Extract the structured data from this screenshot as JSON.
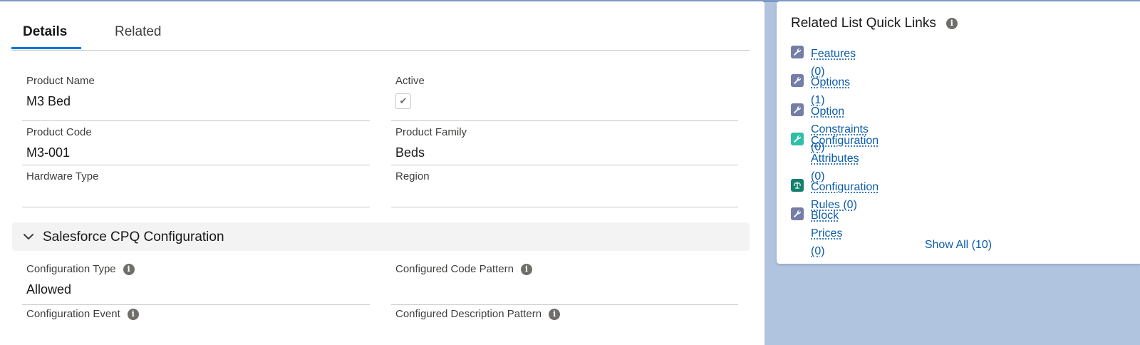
{
  "tabs": [
    {
      "label": "Details"
    },
    {
      "label": "Related"
    }
  ],
  "fields": {
    "product_name": {
      "label": "Product Name",
      "value": "M3 Bed"
    },
    "active": {
      "label": "Active",
      "checked": true
    },
    "product_code": {
      "label": "Product Code",
      "value": "M3-001"
    },
    "product_family": {
      "label": "Product Family",
      "value": "Beds"
    },
    "hardware_type": {
      "label": "Hardware Type",
      "value": ""
    },
    "region": {
      "label": "Region",
      "value": ""
    }
  },
  "section": {
    "title": "Salesforce CPQ Configuration",
    "fields": {
      "configuration_type": {
        "label": "Configuration Type",
        "value": "Allowed"
      },
      "configured_code_pattern": {
        "label": "Configured Code Pattern",
        "value": ""
      },
      "configuration_event": {
        "label": "Configuration Event",
        "value": ""
      },
      "configured_description_pattern": {
        "label": "Configured Description Pattern",
        "value": ""
      }
    }
  },
  "quick_links": {
    "title": "Related List Quick Links",
    "items": [
      {
        "line1": "Features (0)",
        "line2": "",
        "icon": "wrench-icon",
        "color": "#747ea6"
      },
      {
        "line1": "Options (1)",
        "line2": "",
        "icon": "wrench-icon",
        "color": "#747ea6"
      },
      {
        "line1": "Option Constraints (0)",
        "line2": "",
        "icon": "wrench-icon",
        "color": "#747ea6"
      },
      {
        "line1": "Configuration",
        "line2": "Attributes (0)",
        "icon": "wrench-icon",
        "color": "#2fbfa9"
      },
      {
        "line1": "Configuration Rules (0)",
        "line2": "",
        "icon": "scales-icon",
        "color": "#12806d"
      },
      {
        "line1": "Block Prices (0)",
        "line2": "",
        "icon": "wrench-icon",
        "color": "#747ea6"
      }
    ],
    "show_all": "Show All (10)"
  },
  "colors": {
    "background": "#b0c4df",
    "link": "#0b5cab",
    "tab_accent": "#0176d3"
  }
}
